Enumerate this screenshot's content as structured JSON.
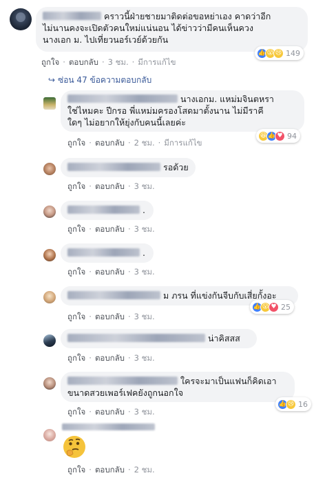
{
  "comment": {
    "text": "คราวนี้ฝ่ายชายมาติดต่อขอหย่าเอง คาดว่าอีกไม่นานคงจะเปิดตัวคนใหม่แน่นอน ได้ข่าวว่ามีคนเห็นควงนางเอก ม. ไปเที่ยวนอร์เวย์ด้วยกัน",
    "line1": "คราวนี้ฝ่ายชายมาติดต่อขอหย่าเอง คาดว่าอีก",
    "line2": "ไม่นานคงจะเปิดตัวคนใหม่แน่นอน ได้ข่าวว่ามีคนเห็นควง",
    "line3": "นางเอก ม. ไปเที่ยวนอร์เวย์ด้วยกัน",
    "like": "ถูกใจ",
    "reply": "ตอบกลับ",
    "time": "3 ชม.",
    "edited": "มีการแก้ไข",
    "reactions": "149"
  },
  "replies_toggle": {
    "icon": "reply-arrow-icon",
    "label": "ซ่อน 47 ข้อความตอบกลับ"
  },
  "replies": [
    {
      "line1": "นางเอกม. แหม่มจินตหรา",
      "line2": "ใช่ไหมคะ ปีกรอ พี่แหม่มครองโสดมาตั้งนาน ไม่มีราคี",
      "line3": "ใดๆ ไม่อยากให้ยุ่งกับคนนี้เลยค่ะ",
      "like": "ถูกใจ",
      "reply": "ตอบกลับ",
      "time": "2 ชม.",
      "edited": "มีการแก้ไข",
      "reactions": "94"
    },
    {
      "text": "รอด้วย",
      "like": "ถูกใจ",
      "reply": "ตอบกลับ",
      "time": "3 ชม."
    },
    {
      "text": ".",
      "like": "ถูกใจ",
      "reply": "ตอบกลับ",
      "time": "3 ชม."
    },
    {
      "text": ".",
      "like": "ถูกใจ",
      "reply": "ตอบกลับ",
      "time": "3 ชม."
    },
    {
      "text": "ม ภรน ที่แข่งกันจีบกับเสี่ยกั้งอะ",
      "like": "ถูกใจ",
      "reply": "ตอบกลับ",
      "time": "3 ชม.",
      "reactions": "25"
    },
    {
      "text": "น่าคิสสส",
      "like": "ถูกใจ",
      "reply": "ตอบกลับ",
      "time": "3 ชม."
    },
    {
      "line1": "ใครจะมาเป็นแฟนก็คิดเอา",
      "line2": "ขนาดสวยเพอร์เฟคยังถูกนอกใจ",
      "like": "ถูกใจ",
      "reply": "ตอบกลับ",
      "time": "3 ชม.",
      "reactions": "16"
    },
    {
      "sticker": "thinking-emoji",
      "like": "ถูกใจ",
      "reply": "ตอบกลับ",
      "time": "2 ชม."
    }
  ],
  "colors": {
    "link": "#385898",
    "bubble": "#f2f3f5",
    "meta": "#90949c",
    "like_blue": "#4080ff"
  }
}
